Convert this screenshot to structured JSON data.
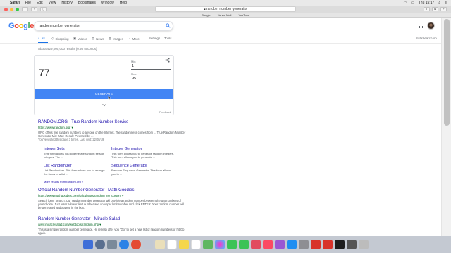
{
  "menubar": {
    "app": "Safari",
    "items": [
      "File",
      "Edit",
      "View",
      "History",
      "Bookmarks",
      "Window",
      "Help"
    ],
    "clock": "Thu 15:17"
  },
  "browser": {
    "url": "random number generator",
    "favorites": [
      "Google",
      "Yahoo Mail",
      "YouTube"
    ]
  },
  "google": {
    "logo_letters": [
      {
        "ch": "G",
        "color": "#4285f4"
      },
      {
        "ch": "o",
        "color": "#ea4335"
      },
      {
        "ch": "o",
        "color": "#fbbc05"
      },
      {
        "ch": "g",
        "color": "#4285f4"
      },
      {
        "ch": "l",
        "color": "#34a853"
      },
      {
        "ch": "e",
        "color": "#ea4335"
      }
    ],
    "query": "random number generator",
    "tabs": [
      {
        "label": "All",
        "icon": "search-icon"
      },
      {
        "label": "Shopping",
        "icon": "tag-icon"
      },
      {
        "label": "Videos",
        "icon": "video-icon"
      },
      {
        "label": "News",
        "icon": "news-icon"
      },
      {
        "label": "Images",
        "icon": "image-icon"
      },
      {
        "label": "More",
        "icon": "more-icon"
      }
    ],
    "settings": "Settings",
    "tools": "Tools",
    "safesearch": "SafeSearch on",
    "results_count": "About 429,000,000 results (0.56 seconds)"
  },
  "rng": {
    "result": "77",
    "min_label": "Min",
    "min_value": "1",
    "max_label": "Max",
    "max_value": "95",
    "generate_label": "GENERATE",
    "feedback": "Feedback"
  },
  "results": [
    {
      "title": "RANDOM.ORG - True Random Number Service",
      "url": "https://www.random.org/ ▾",
      "snippet": "ORG offers true random numbers to anyone on the Internet. The randomness comes from ... True Random Number Generator Min: Max: Result: Powered by ...",
      "visited": "You've visited this page 3 times. Last visit: 22/08/19"
    },
    {
      "title": "Official Random Number Generator | Math Goodies",
      "url": "https://www.mathgoodies.com/calculators/random_no_custom ▾",
      "snippet": "Search form. Search. Our random number generator will provide a random number between the two numbers of your choice. Just enter a lower limit number and an upper limit number and click ENTER. Your random number will be generated and appear in the box."
    },
    {
      "title": "Random Number Generator - Miracle Salad",
      "url": "www.miraclesalad.com/webtools/random.php ▾",
      "snippet": "This is a simple random number generator. Hit refresh after you \"Go\" to get a new list of random numbers or hit Go again."
    }
  ],
  "sitelinks": [
    {
      "title": "Integer Sets",
      "desc": "This form allows you to generate random sets of integers. The ..."
    },
    {
      "title": "Integer Generator",
      "desc": "This form allows you to generate random integers. This form allows you to generate ..."
    },
    {
      "title": "List Randomizer",
      "desc": "List Randomizer. This form allows you to arrange the items of a list ..."
    },
    {
      "title": "Sequence Generator",
      "desc": "Random Sequence Generator. This form allows you to ..."
    }
  ],
  "more_results": "More results from random.org »",
  "colors": {
    "accent": "#4285f4",
    "link": "#1a0dab",
    "url_green": "#006621"
  }
}
